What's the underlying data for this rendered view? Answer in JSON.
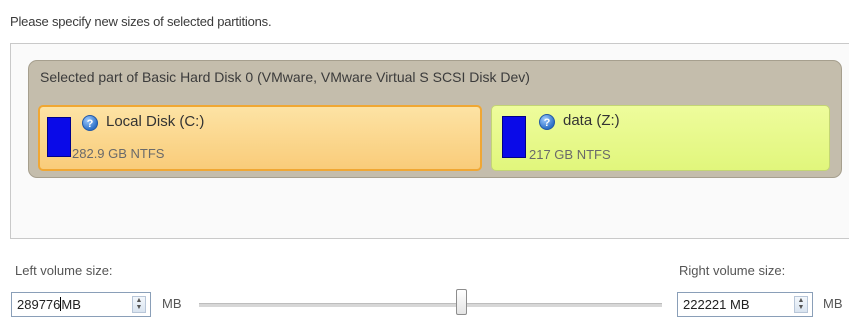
{
  "instruction": "Please specify new sizes of selected partitions.",
  "disk": {
    "title": "Selected part of Basic Hard Disk 0 (VMware, VMware Virtual S SCSI Disk Dev)"
  },
  "partitions": [
    {
      "name": "Local Disk (C:)",
      "size_label": "282.9 GB NTFS",
      "color": "#0a0ae8",
      "help_glyph": "?",
      "selected": true
    },
    {
      "name": "data (Z:)",
      "size_label": "217 GB NTFS",
      "color": "#0a0ae8",
      "help_glyph": "?",
      "selected": false
    }
  ],
  "left_volume": {
    "label": "Left volume size:",
    "value": "289776",
    "inline_unit": "MB",
    "unit": "MB"
  },
  "right_volume": {
    "label": "Right volume size:",
    "value": "222221 MB",
    "unit": "MB"
  },
  "slider": {
    "position_fraction": 0.566
  },
  "colors": {
    "selected_partition_border": "#f0a733",
    "selected_partition_fill": "#f9cc7a",
    "other_partition_fill": "#e1f67c",
    "disk_frame": "#c4bdac"
  },
  "icons": {
    "help": "help-icon",
    "spin_up": "spin-up-icon",
    "spin_down": "spin-down-icon"
  }
}
